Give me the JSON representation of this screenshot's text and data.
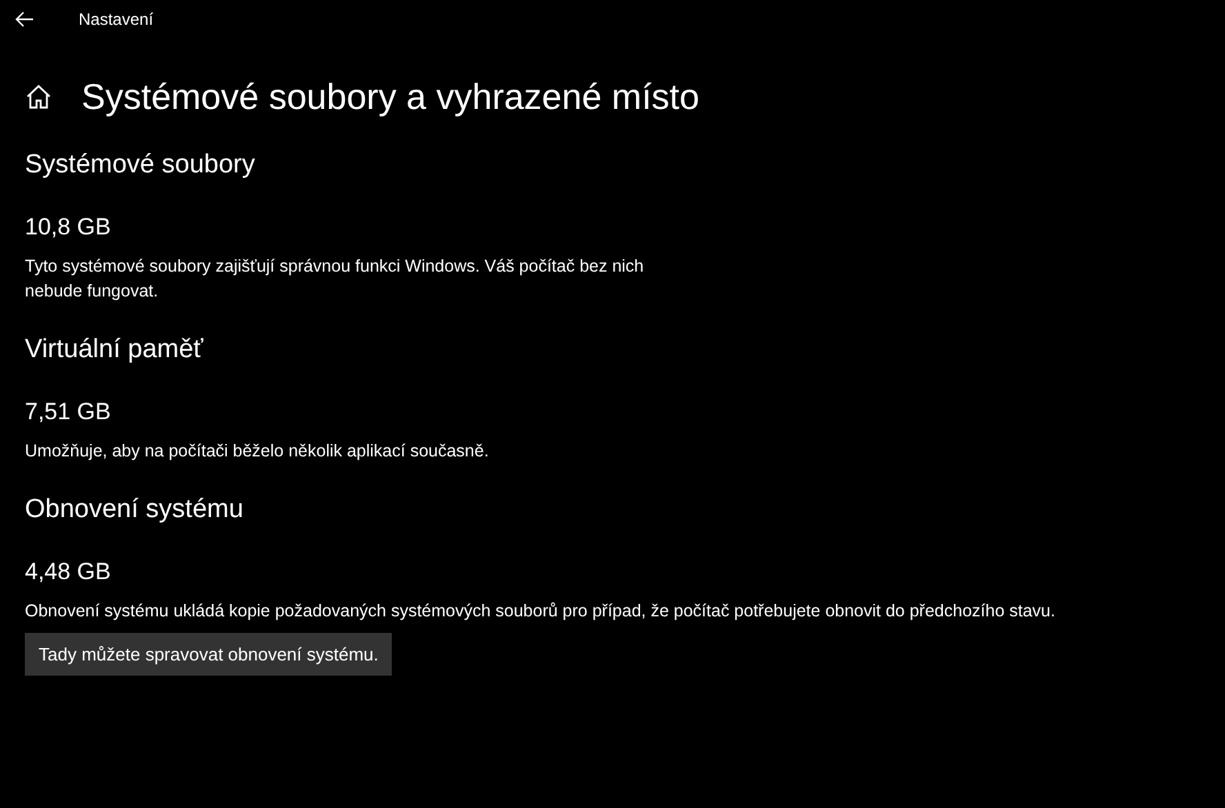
{
  "window": {
    "title": "Nastavení"
  },
  "page": {
    "title": "Systémové soubory a vyhrazené místo"
  },
  "sections": [
    {
      "heading": "Systémové soubory",
      "value": "10,8 GB",
      "description": "Tyto systémové soubory zajišťují správnou funkci Windows. Váš počítač bez nich nebude fungovat."
    },
    {
      "heading": "Virtuální paměť",
      "value": "7,51 GB",
      "description": "Umožňuje, aby na počítači běželo několik aplikací současně."
    },
    {
      "heading": "Obnovení systému",
      "value": "4,48 GB",
      "description": "Obnovení systému ukládá kopie požadovaných systémových souborů pro případ, že počítač potřebujete obnovit do předchozího stavu.",
      "button": "Tady můžete spravovat obnovení systému."
    }
  ]
}
